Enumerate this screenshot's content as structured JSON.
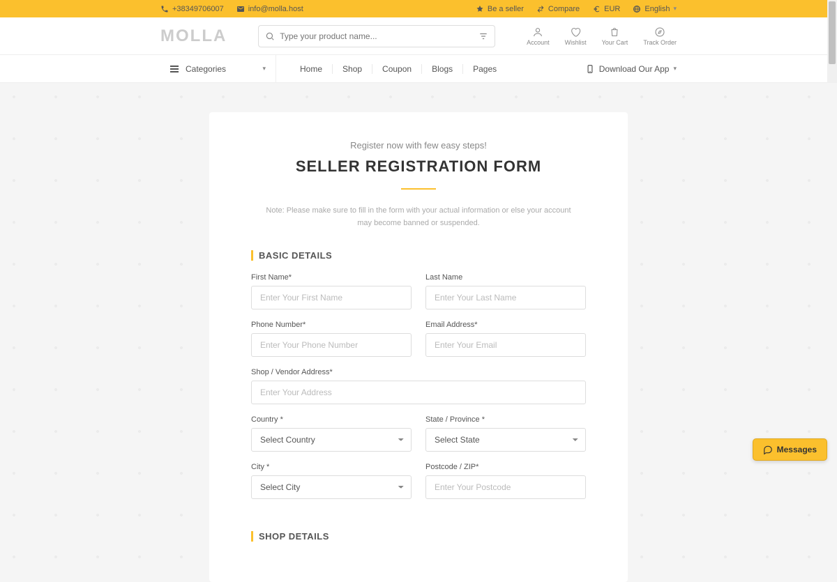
{
  "topbar": {
    "phone": "+38349706007",
    "email": "info@molla.host",
    "seller": "Be a seller",
    "compare": "Compare",
    "currency": "EUR",
    "language": "English"
  },
  "header": {
    "logo": "MOLLA",
    "search_placeholder": "Type your product name...",
    "account": "Account",
    "wishlist": "Wishlist",
    "cart": "Your Cart",
    "track": "Track Order"
  },
  "nav": {
    "categories": "Categories",
    "links": [
      "Home",
      "Shop",
      "Coupon",
      "Blogs",
      "Pages"
    ],
    "download": "Download Our App"
  },
  "form": {
    "subtitle": "Register now with few easy steps!",
    "title": "SELLER REGISTRATION FORM",
    "note": "Note: Please make sure to fill in the form with your actual information or else your account may become banned or suspended.",
    "section_basic": "BASIC DETAILS",
    "section_shop": "SHOP DETAILS",
    "first_name_label": "First Name*",
    "first_name_ph": "Enter Your First Name",
    "last_name_label": "Last Name",
    "last_name_ph": "Enter Your Last Name",
    "phone_label": "Phone Number*",
    "phone_ph": "Enter Your Phone Number",
    "email_label": "Email Address*",
    "email_ph": "Enter Your Email",
    "address_label": "Shop / Vendor Address*",
    "address_ph": "Enter Your Address",
    "country_label": "Country *",
    "country_sel": "Select Country",
    "state_label": "State / Province *",
    "state_sel": "Select State",
    "city_label": "City *",
    "city_sel": "Select City",
    "postcode_label": "Postcode / ZIP*",
    "postcode_ph": "Enter Your Postcode"
  },
  "widget": {
    "messages": "Messages"
  }
}
